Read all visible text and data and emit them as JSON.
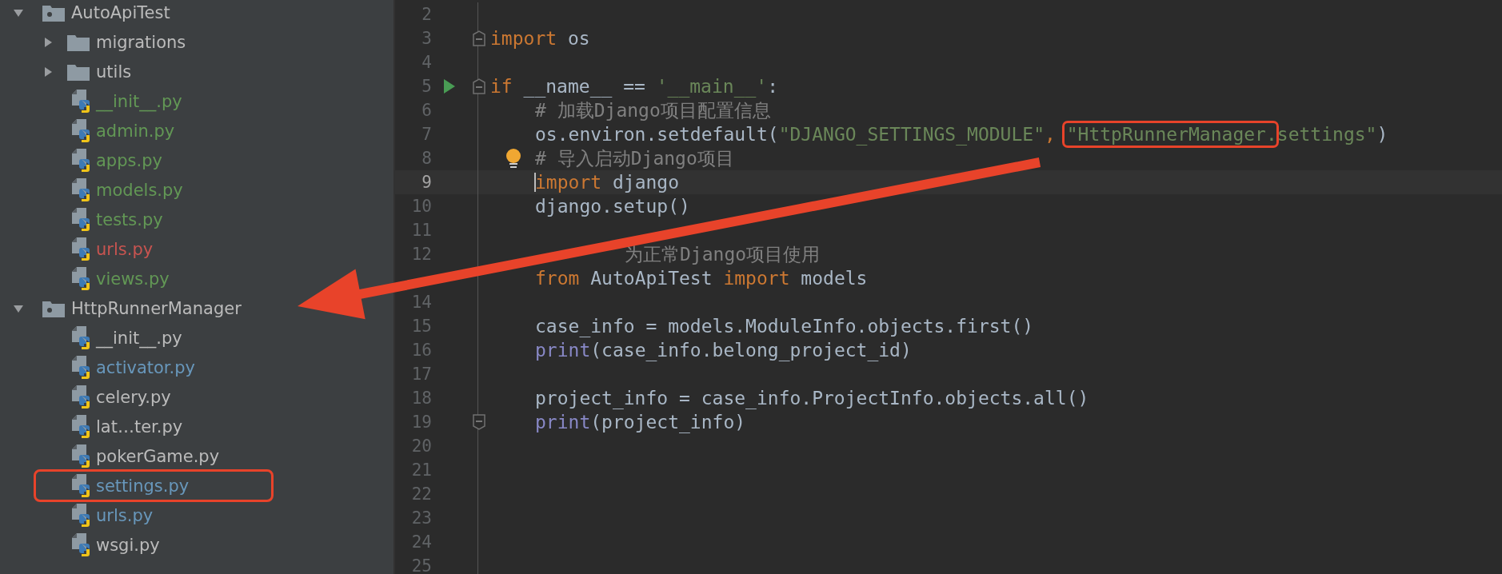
{
  "project_tree": [
    {
      "kind": "folder",
      "name": "AutoApiTest",
      "expanded": true,
      "children": [
        {
          "kind": "folder",
          "name": "migrations",
          "expanded": false
        },
        {
          "kind": "folder",
          "name": "utils",
          "expanded": false
        },
        {
          "kind": "file",
          "name": "__init__.py",
          "color": "#629755"
        },
        {
          "kind": "file",
          "name": "admin.py",
          "color": "#629755"
        },
        {
          "kind": "file",
          "name": "apps.py",
          "color": "#629755"
        },
        {
          "kind": "file",
          "name": "models.py",
          "color": "#629755"
        },
        {
          "kind": "file",
          "name": "tests.py",
          "color": "#629755"
        },
        {
          "kind": "file",
          "name": "urls.py",
          "color": "#c75450"
        },
        {
          "kind": "file",
          "name": "views.py",
          "color": "#629755"
        }
      ]
    },
    {
      "kind": "folder",
      "name": "HttpRunnerManager",
      "expanded": true,
      "children": [
        {
          "kind": "file",
          "name": "__init__.py",
          "color": "#bbbbbb"
        },
        {
          "kind": "file",
          "name": "activator.py",
          "color": "#6897bb"
        },
        {
          "kind": "file",
          "name": "celery.py",
          "color": "#bbbbbb"
        },
        {
          "kind": "file",
          "name": "lat…ter.py",
          "color": "#bbbbbb"
        },
        {
          "kind": "file",
          "name": "pokerGame.py",
          "color": "#bbbbbb"
        },
        {
          "kind": "file",
          "name": "settings.py",
          "color": "#6897bb",
          "highlighted": true
        },
        {
          "kind": "file",
          "name": "urls.py",
          "color": "#6897bb"
        },
        {
          "kind": "file",
          "name": "wsgi.py",
          "color": "#bbbbbb"
        }
      ]
    }
  ],
  "editor": {
    "lines": [
      {
        "number": "2"
      },
      {
        "number": "3",
        "fold_start": true,
        "tokens": [
          {
            "kind": "kw",
            "text": "import"
          },
          {
            "kind": "plain",
            "text": " os"
          }
        ]
      },
      {
        "number": "4"
      },
      {
        "number": "5",
        "run": true,
        "fold_start": true,
        "tokens": [
          {
            "kind": "kw",
            "text": "if"
          },
          {
            "kind": "plain",
            "text": " __name__ == "
          },
          {
            "kind": "str",
            "text": "'__main__'"
          },
          {
            "kind": "plain",
            "text": ":"
          }
        ]
      },
      {
        "number": "6",
        "indented": true,
        "tokens": [
          {
            "kind": "comment",
            "text": "# 加载Django项目配置信息"
          }
        ]
      },
      {
        "number": "7",
        "indented": true,
        "tokens": [
          {
            "kind": "plain",
            "text": "os.environ.setdefault("
          },
          {
            "kind": "str",
            "text": "\"DJANGO_SETTINGS_MODULE\""
          },
          {
            "kind": "kw",
            "text": ", "
          },
          {
            "kind": "str",
            "text": "\"HttpRunnerManager.",
            "highlighted": true
          },
          {
            "kind": "str",
            "text": "settings\""
          },
          {
            "kind": "plain",
            "text": ")"
          }
        ]
      },
      {
        "number": "8",
        "indented": true,
        "bulb": true,
        "tokens": [
          {
            "kind": "comment",
            "text": "# 导入启动Django项目"
          }
        ]
      },
      {
        "number": "9",
        "indented": true,
        "current": true,
        "tokens": [
          {
            "kind": "kw",
            "text": "import"
          },
          {
            "kind": "plain",
            "text": " django"
          }
        ]
      },
      {
        "number": "10",
        "indented": true,
        "tokens": [
          {
            "kind": "plain",
            "text": "django.setup()"
          }
        ]
      },
      {
        "number": "11"
      },
      {
        "number": "12",
        "indented": true,
        "tokens": [
          {
            "kind": "comment",
            "text": "为正常Django项目使用",
            "partly_covered": true
          }
        ]
      },
      {
        "indented": true,
        "tokens": [
          {
            "kind": "kw",
            "text": "from"
          },
          {
            "kind": "plain",
            "text": " AutoApiTest "
          },
          {
            "kind": "kw",
            "text": "import"
          },
          {
            "kind": "plain",
            "text": " models"
          }
        ]
      },
      {
        "number": "14"
      },
      {
        "number": "15",
        "indented": true,
        "tokens": [
          {
            "kind": "plain",
            "text": "case_info = models.ModuleInfo.objects.first()"
          }
        ]
      },
      {
        "number": "16",
        "indented": true,
        "tokens": [
          {
            "kind": "builtin",
            "text": "print"
          },
          {
            "kind": "plain",
            "text": "(case_info.belong_project_id)"
          }
        ]
      },
      {
        "number": "17"
      },
      {
        "number": "18",
        "indented": true,
        "tokens": [
          {
            "kind": "plain",
            "text": "project_info = case_info.ProjectInfo.objects.all()"
          }
        ]
      },
      {
        "number": "19",
        "indented": true,
        "fold_end": true,
        "tokens": [
          {
            "kind": "builtin",
            "text": "print"
          },
          {
            "kind": "plain",
            "text": "(project_info)"
          }
        ]
      },
      {
        "number": "20"
      },
      {
        "number": "21"
      },
      {
        "number": "22"
      },
      {
        "number": "23"
      },
      {
        "number": "24"
      },
      {
        "number": "25"
      }
    ]
  }
}
